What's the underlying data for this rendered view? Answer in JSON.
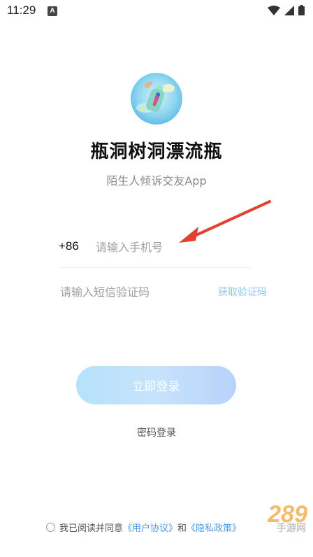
{
  "status_bar": {
    "time": "11:29",
    "notification_icon": "A"
  },
  "app": {
    "title": "瓶洞树洞漂流瓶",
    "subtitle": "陌生人倾诉交友App"
  },
  "login": {
    "country_code": "+86",
    "phone_placeholder": "请输入手机号",
    "sms_placeholder": "请输入短信验证码",
    "get_code_label": "获取验证码",
    "login_button": "立即登录",
    "password_login": "密码登录"
  },
  "agreement": {
    "prefix": "我已阅读并同意",
    "user_agreement": "《用户协议》",
    "and": "和",
    "privacy_policy": "《隐私政策》"
  },
  "watermark": {
    "logo": "289",
    "text": "手游网"
  },
  "colors": {
    "accent": "#8ecbf0",
    "link": "#4a9ae6",
    "arrow": "#e2412f"
  }
}
